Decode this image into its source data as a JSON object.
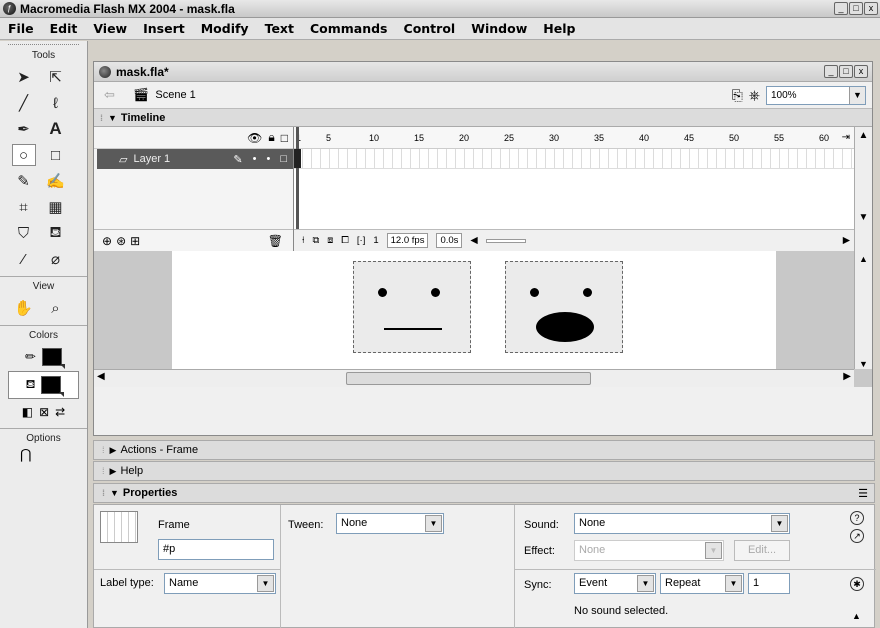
{
  "window": {
    "title": "Macromedia Flash MX 2004 - mask.fla",
    "controls": [
      "_",
      "□",
      "x"
    ]
  },
  "menu": [
    "File",
    "Edit",
    "View",
    "Insert",
    "Modify",
    "Text",
    "Commands",
    "Control",
    "Window",
    "Help"
  ],
  "tools": {
    "heading": "Tools",
    "view_heading": "View",
    "colors_heading": "Colors",
    "options_heading": "Options",
    "items": [
      "arrow",
      "subselect",
      "line",
      "lasso",
      "pen",
      "text",
      "oval",
      "rectangle",
      "pencil",
      "brush",
      "free-transform",
      "fill-transform",
      "ink-bottle",
      "paint-bucket",
      "eyedropper",
      "eraser"
    ],
    "view_items": [
      "hand",
      "zoom"
    ],
    "stroke_color": "#000000",
    "fill_color": "#000000"
  },
  "document": {
    "title": "mask.fla*",
    "scene": "Scene 1",
    "zoom": "100%"
  },
  "timeline": {
    "header": "Timeline",
    "layer_name": "Layer 1",
    "frame_ticks": [
      "1",
      "5",
      "10",
      "15",
      "20",
      "25",
      "30",
      "35",
      "40",
      "45",
      "50",
      "55",
      "60"
    ],
    "current_frame": "1",
    "fps": "12.0 fps",
    "elapsed": "0.0s"
  },
  "panels": {
    "actions": "Actions - Frame",
    "help": "Help",
    "properties": "Properties"
  },
  "properties": {
    "frame_label": "Frame",
    "frame_name_value": "#p",
    "tween_label": "Tween:",
    "tween_value": "None",
    "sound_label": "Sound:",
    "sound_value": "None",
    "effect_label": "Effect:",
    "effect_value": "None",
    "edit_button": "Edit...",
    "label_type_label": "Label type:",
    "label_type_value": "Name",
    "sync_label": "Sync:",
    "sync_value": "Event",
    "repeat_value": "Repeat",
    "repeat_count": "1",
    "status": "No sound selected."
  }
}
